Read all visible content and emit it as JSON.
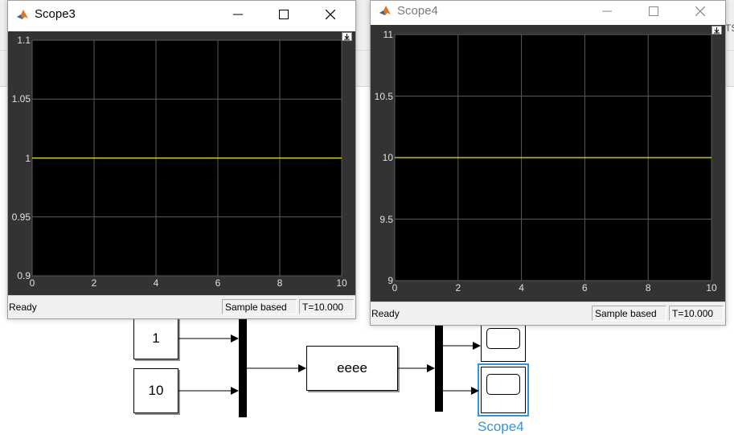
{
  "scope3": {
    "title": "Scope3",
    "y_ticks": [
      "1.1",
      "1.05",
      "1",
      "0.95",
      "0.9"
    ],
    "x_ticks": [
      "0",
      "2",
      "4",
      "6",
      "8",
      "10"
    ],
    "status_ready": "Ready",
    "status_sample": "Sample based",
    "status_time": "T=10.000"
  },
  "scope4": {
    "title": "Scope4",
    "y_ticks": [
      "11",
      "10.5",
      "10",
      "9.5",
      "9"
    ],
    "x_ticks": [
      "0",
      "2",
      "4",
      "6",
      "8",
      "10"
    ],
    "status_ready": "Ready",
    "status_sample": "Sample based",
    "status_time": "T=10.000"
  },
  "model": {
    "const1_value": "1",
    "const2_value": "10",
    "subsystem_label": "eeee",
    "scope4_label": "Scope4",
    "bg_fragment": "TS"
  },
  "colors": {
    "signal": "#e6e600",
    "grid": "#5a5a5a",
    "selection": "#2f96db"
  },
  "chart_data": [
    {
      "type": "line",
      "title": "",
      "xlim": [
        0,
        10
      ],
      "ylim": [
        0.9,
        1.1
      ],
      "grid": true,
      "series": [
        {
          "x": [
            0,
            10
          ],
          "y": [
            1,
            1
          ]
        }
      ]
    },
    {
      "type": "line",
      "title": "",
      "xlim": [
        0,
        10
      ],
      "ylim": [
        9,
        11
      ],
      "grid": true,
      "series": [
        {
          "x": [
            0,
            10
          ],
          "y": [
            10,
            10
          ]
        }
      ]
    }
  ]
}
